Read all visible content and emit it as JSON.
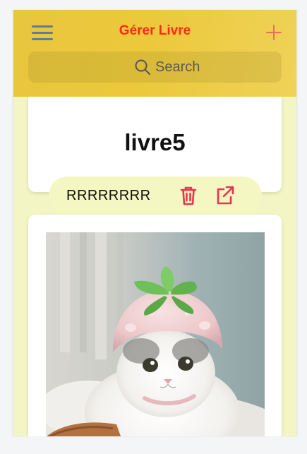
{
  "header": {
    "title": "Gérer Livre",
    "menu_icon": "hamburger-menu-icon",
    "add_icon": "plus-icon",
    "title_color": "#ff2a1a",
    "background_color": "#ecc83a"
  },
  "search": {
    "placeholder": "Search",
    "icon": "search-icon"
  },
  "books": [
    {
      "title": "livre5",
      "label": "RRRRRRRR",
      "actions": [
        "trash-icon",
        "external-link-icon"
      ]
    },
    {
      "image": "kitten-in-pink-strawberry-hat"
    }
  ],
  "colors": {
    "page_background": "#f3f6c4",
    "pill_background": "#f5f7c2",
    "action_icon": "#e8344e"
  }
}
